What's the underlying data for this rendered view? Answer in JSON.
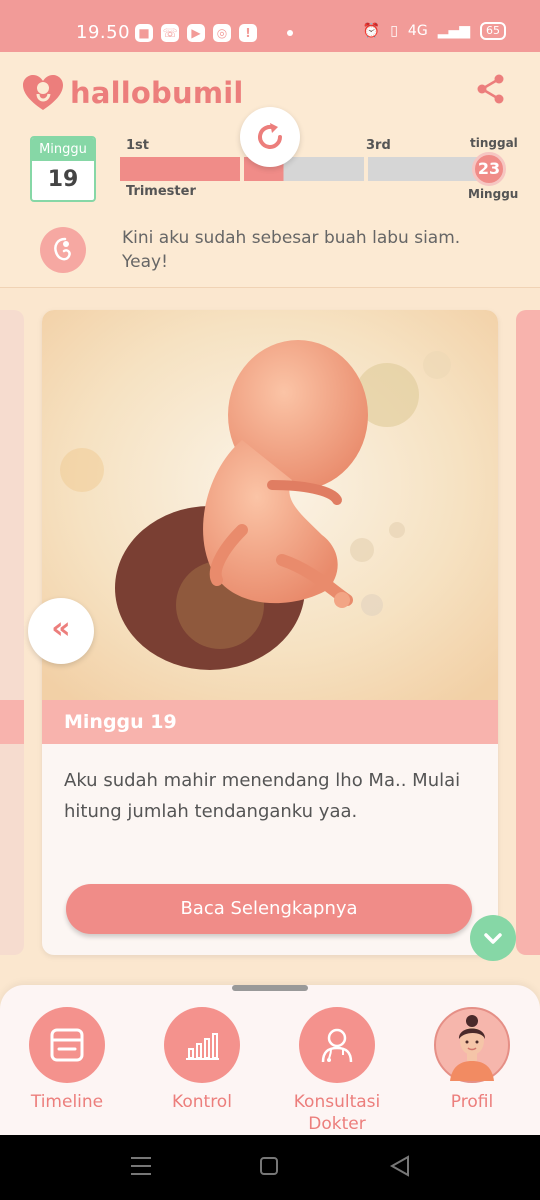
{
  "status_bar": {
    "time": "19.50",
    "battery": "65",
    "network": "4G"
  },
  "header": {
    "app_name": "hallobumil",
    "week_label": "Minggu",
    "week_number": "19",
    "progress": {
      "first_label": "1st",
      "third_label": "3rd",
      "trimester_label": "Trimester",
      "remaining_top": "tinggal",
      "remaining_number": "23",
      "remaining_bottom": "Minggu",
      "fill_fraction": 0.44
    },
    "info_text": "Kini aku sudah sebesar buah labu siam. Yeay!"
  },
  "card": {
    "title": "Minggu 19",
    "body": "Aku sudah mahir menendang lho Ma.. Mulai hitung jumlah tendanganku yaa.",
    "button_label": "Baca Selengkapnya",
    "prev_icon": "«"
  },
  "bottom_nav": {
    "items": [
      {
        "label": "Timeline",
        "icon": "timeline-icon"
      },
      {
        "label": "Kontrol",
        "icon": "chart-icon"
      },
      {
        "label": "Konsultasi Dokter",
        "icon": "doctor-icon"
      },
      {
        "label": "Profil",
        "icon": "avatar"
      }
    ]
  },
  "colors": {
    "primary": "#f08c88",
    "accent": "#86d7a6",
    "background": "#fbe7cf"
  }
}
